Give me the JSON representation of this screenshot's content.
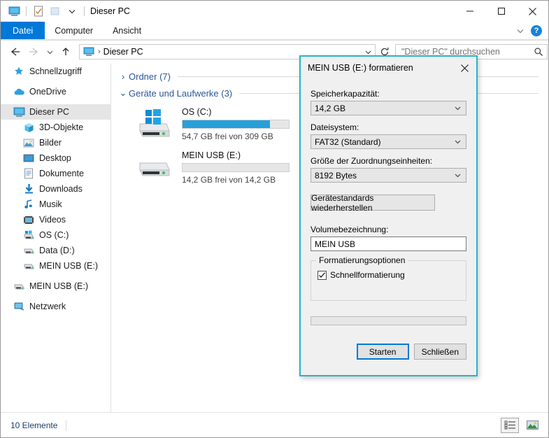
{
  "window": {
    "title": "Dieser PC",
    "quick_access": [
      "this-pc-icon",
      "properties-icon",
      "new-folder-icon",
      "customize-qat-chevron"
    ],
    "controls": {
      "minimize": "–",
      "maximize": "□",
      "close": "✕"
    }
  },
  "ribbon": {
    "tabs": [
      {
        "label": "Datei",
        "selected": true
      },
      {
        "label": "Computer",
        "selected": false
      },
      {
        "label": "Ansicht",
        "selected": false
      }
    ],
    "expand_label": "⌄",
    "help_label": "?"
  },
  "address": {
    "back_tooltip": "Zurück",
    "forward_tooltip": "Vorwärts",
    "recent_tooltip": "Zuletzt besuchte Orte",
    "up_tooltip": "Aufwärts",
    "breadcrumb": "Dieser PC",
    "separator": "›",
    "refresh_tooltip": "Aktualisieren"
  },
  "search": {
    "placeholder": "\"Dieser PC\" durchsuchen",
    "value": ""
  },
  "sidebar": {
    "items": [
      {
        "label": "Schnellzugriff",
        "icon": "star-icon",
        "level": 0,
        "selected": false,
        "gap_before": false
      },
      {
        "label": "OneDrive",
        "icon": "cloud-icon",
        "level": 0,
        "selected": false,
        "gap_before": true
      },
      {
        "label": "Dieser PC",
        "icon": "this-pc-icon",
        "level": 0,
        "selected": true,
        "gap_before": true
      },
      {
        "label": "3D-Objekte",
        "icon": "3d-objects-icon",
        "level": 1,
        "selected": false,
        "gap_before": false
      },
      {
        "label": "Bilder",
        "icon": "pictures-icon",
        "level": 1,
        "selected": false,
        "gap_before": false
      },
      {
        "label": "Desktop",
        "icon": "desktop-icon",
        "level": 1,
        "selected": false,
        "gap_before": false
      },
      {
        "label": "Dokumente",
        "icon": "documents-icon",
        "level": 1,
        "selected": false,
        "gap_before": false
      },
      {
        "label": "Downloads",
        "icon": "downloads-icon",
        "level": 1,
        "selected": false,
        "gap_before": false
      },
      {
        "label": "Musik",
        "icon": "music-icon",
        "level": 1,
        "selected": false,
        "gap_before": false
      },
      {
        "label": "Videos",
        "icon": "videos-icon",
        "level": 1,
        "selected": false,
        "gap_before": false
      },
      {
        "label": "OS (C:)",
        "icon": "windows-drive-icon",
        "level": 1,
        "selected": false,
        "gap_before": false
      },
      {
        "label": "Data (D:)",
        "icon": "drive-icon",
        "level": 1,
        "selected": false,
        "gap_before": false
      },
      {
        "label": "MEIN USB (E:)",
        "icon": "drive-icon",
        "level": 1,
        "selected": false,
        "gap_before": false
      },
      {
        "label": "MEIN USB (E:)",
        "icon": "drive-icon",
        "level": 0,
        "selected": false,
        "gap_before": true
      },
      {
        "label": "Netzwerk",
        "icon": "network-icon",
        "level": 0,
        "selected": false,
        "gap_before": true
      }
    ]
  },
  "content": {
    "groups": [
      {
        "label": "Ordner (7)",
        "expanded": false,
        "chevron": "›"
      },
      {
        "label": "Geräte und Laufwerke (3)",
        "expanded": true,
        "chevron": "⌄"
      }
    ],
    "drives": [
      {
        "name": "OS (C:)",
        "capacity_text": "54,7 GB frei von 309 GB",
        "used_percent": 82,
        "icon": "windows-drive-icon"
      },
      {
        "name": "MEIN USB (E:)",
        "capacity_text": "14,2 GB frei von 14,2 GB",
        "used_percent": 0,
        "icon": "drive-icon"
      }
    ]
  },
  "statusbar": {
    "item_count": "10 Elemente",
    "views": [
      {
        "name": "details-view-icon",
        "active": true
      },
      {
        "name": "large-icons-view-icon",
        "active": false
      }
    ]
  },
  "dialog": {
    "title": "MEIN USB (E:) formatieren",
    "close_label": "✕",
    "border_color": "#2bb3c6",
    "fields": [
      {
        "label": "Speicherkapazität:",
        "value": "14,2 GB",
        "name": "capacity-select"
      },
      {
        "label": "Dateisystem:",
        "value": "FAT32 (Standard)",
        "name": "filesystem-select"
      },
      {
        "label": "Größe der Zuordnungseinheiten:",
        "value": "8192 Bytes",
        "name": "allocation-unit-select"
      }
    ],
    "restore_button": "Gerätestandards wiederherstellen",
    "volume_label_caption": "Volumebezeichnung:",
    "volume_label_value": "MEIN USB",
    "options_legend": "Formatierungsoptionen",
    "quick_format_label": "Schnellformatierung",
    "quick_format_checked": true,
    "progress_percent": 0,
    "start_button": "Starten",
    "close_button": "Schließen"
  }
}
